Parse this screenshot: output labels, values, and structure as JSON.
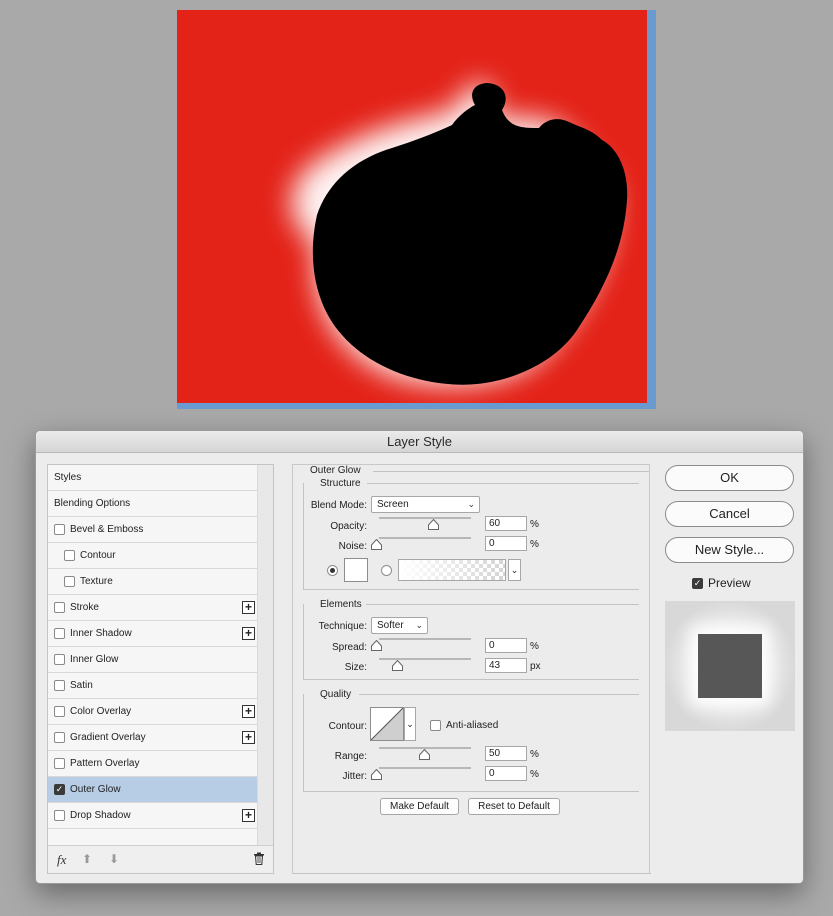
{
  "dialog": {
    "title": "Layer Style",
    "buttons": {
      "ok": "OK",
      "cancel": "Cancel",
      "new_style": "New Style..."
    },
    "preview": {
      "label": "Preview",
      "checked": true
    }
  },
  "styles_list": {
    "header": "Styles",
    "blending_options": "Blending Options",
    "items": [
      {
        "label": "Bevel & Emboss",
        "checked": false,
        "has_plus": false
      },
      {
        "label": "Contour",
        "checked": false,
        "has_plus": false,
        "indent": true
      },
      {
        "label": "Texture",
        "checked": false,
        "has_plus": false,
        "indent": true
      },
      {
        "label": "Stroke",
        "checked": false,
        "has_plus": true
      },
      {
        "label": "Inner Shadow",
        "checked": false,
        "has_plus": true
      },
      {
        "label": "Inner Glow",
        "checked": false,
        "has_plus": false
      },
      {
        "label": "Satin",
        "checked": false,
        "has_plus": false
      },
      {
        "label": "Color Overlay",
        "checked": false,
        "has_plus": true
      },
      {
        "label": "Gradient Overlay",
        "checked": false,
        "has_plus": true
      },
      {
        "label": "Pattern Overlay",
        "checked": false,
        "has_plus": false
      },
      {
        "label": "Outer Glow",
        "checked": true,
        "has_plus": false,
        "selected": true
      },
      {
        "label": "Drop Shadow",
        "checked": false,
        "has_plus": true
      }
    ],
    "footer": {
      "fx": "fx",
      "up_icon": "arrow-up-icon",
      "down_icon": "arrow-down-icon",
      "trash_icon": "trash-icon"
    }
  },
  "outer_glow": {
    "title": "Outer Glow",
    "structure": {
      "title": "Structure",
      "blend_mode_label": "Blend Mode:",
      "blend_mode": "Screen",
      "opacity_label": "Opacity:",
      "opacity": "60",
      "opacity_unit": "%",
      "noise_label": "Noise:",
      "noise": "0",
      "noise_unit": "%",
      "color_mode": "solid",
      "glow_color": "#ffffff"
    },
    "elements": {
      "title": "Elements",
      "technique_label": "Technique:",
      "technique": "Softer",
      "spread_label": "Spread:",
      "spread": "0",
      "spread_unit": "%",
      "size_label": "Size:",
      "size": "43",
      "size_unit": "px"
    },
    "quality": {
      "title": "Quality",
      "contour_label": "Contour:",
      "anti_aliased_label": "Anti-aliased",
      "anti_aliased": false,
      "range_label": "Range:",
      "range": "50",
      "range_unit": "%",
      "jitter_label": "Jitter:",
      "jitter": "0",
      "jitter_unit": "%"
    },
    "make_default": "Make Default",
    "reset_default": "Reset to Default"
  },
  "canvas": {
    "background_color": "#e32218",
    "shape_color": "#000000",
    "glow_color": "#ffffff"
  }
}
